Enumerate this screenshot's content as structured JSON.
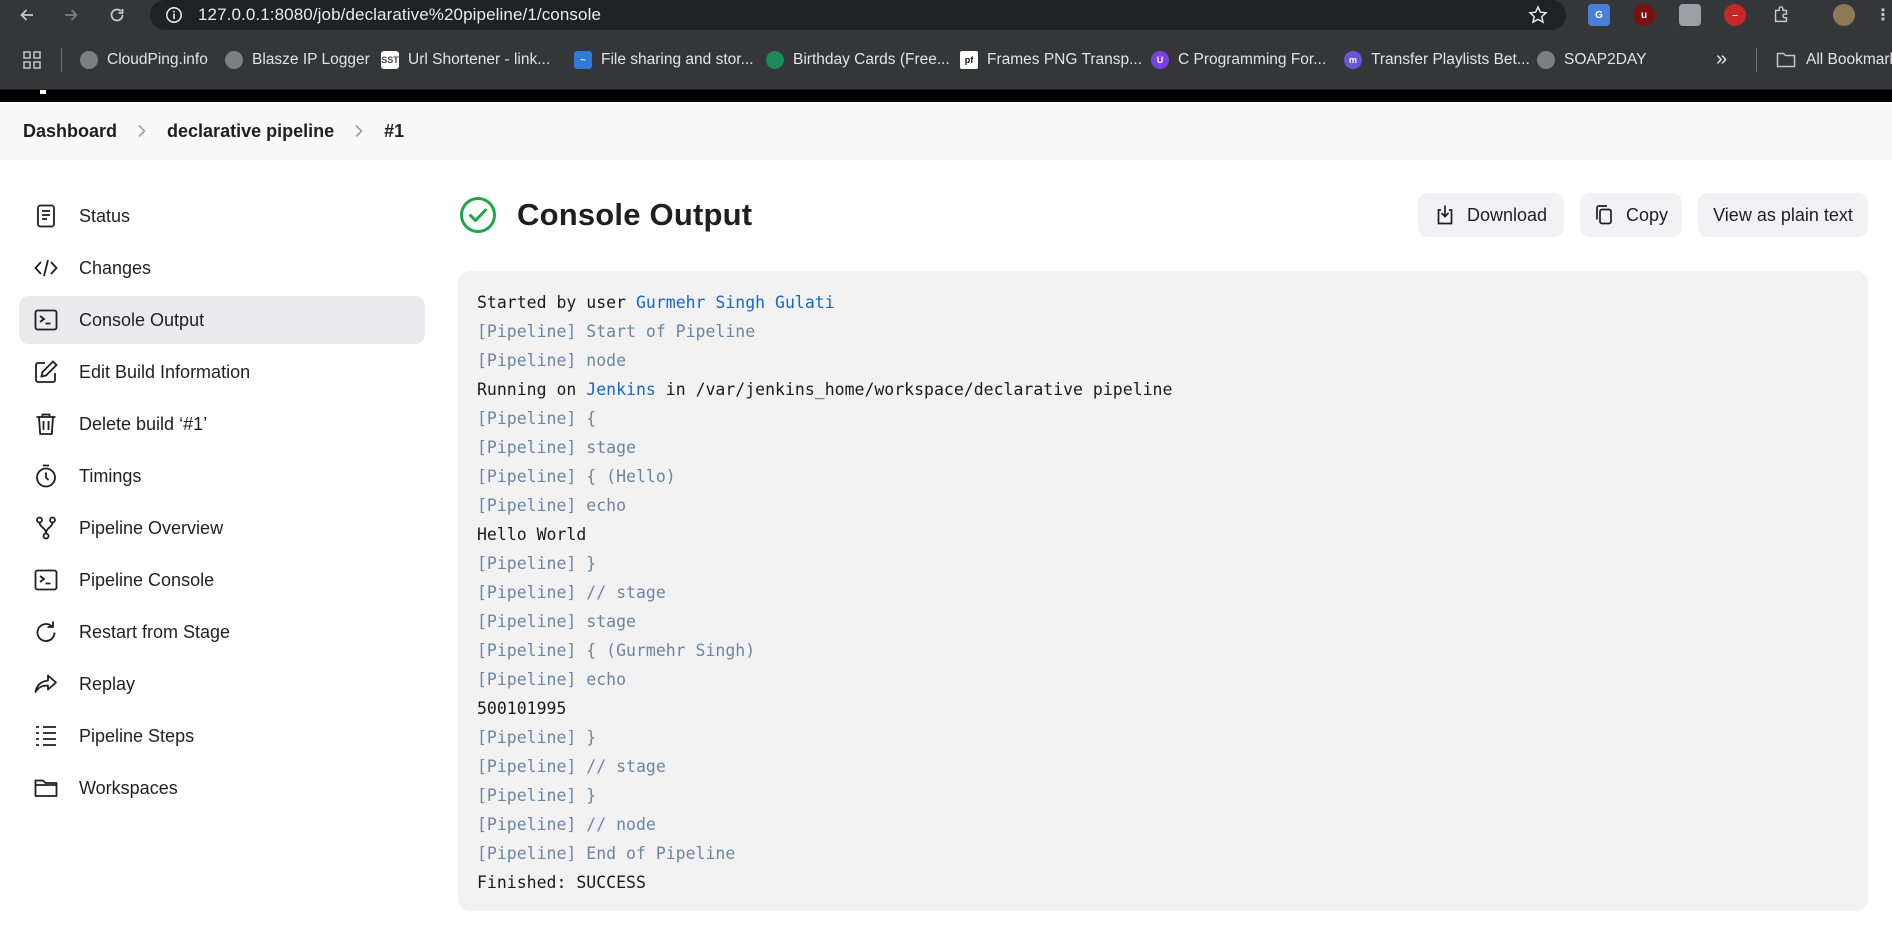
{
  "browser": {
    "url": "127.0.0.1:8080/job/declarative%20pipeline/1/console",
    "bookmarks": [
      {
        "label": "CloudPing.info"
      },
      {
        "label": "Blasze IP Logger"
      },
      {
        "label": "Url Shortener - link..."
      },
      {
        "label": "File sharing and stor..."
      },
      {
        "label": "Birthday Cards (Free..."
      },
      {
        "label": "Frames PNG Transp..."
      },
      {
        "label": "C Programming For..."
      },
      {
        "label": "Transfer Playlists Bet..."
      },
      {
        "label": "SOAP2DAY"
      }
    ],
    "all_bookmarks": "All Bookmarks"
  },
  "breadcrumb": {
    "items": [
      "Dashboard",
      "declarative pipeline",
      "#1"
    ]
  },
  "sidebar": {
    "items": [
      {
        "label": "Status"
      },
      {
        "label": "Changes"
      },
      {
        "label": "Console Output"
      },
      {
        "label": "Edit Build Information"
      },
      {
        "label": "Delete build ‘#1’"
      },
      {
        "label": "Timings"
      },
      {
        "label": "Pipeline Overview"
      },
      {
        "label": "Pipeline Console"
      },
      {
        "label": "Restart from Stage"
      },
      {
        "label": "Replay"
      },
      {
        "label": "Pipeline Steps"
      },
      {
        "label": "Workspaces"
      }
    ],
    "active": "Console Output"
  },
  "main": {
    "title": "Console Output",
    "buttons": {
      "download": "Download",
      "copy": "Copy",
      "plain": "View as plain text"
    },
    "console": {
      "started_prefix": "Started by user ",
      "user": "Gurmehr Singh Gulati",
      "running_prefix": "Running on ",
      "running_node": "Jenkins",
      "running_suffix": " in /var/jenkins_home/workspace/declarative pipeline",
      "pipeline_tag": "[Pipeline]",
      "lines": [
        " Start of Pipeline",
        " node",
        " {",
        " stage",
        " { (Hello)",
        " echo",
        " }",
        " // stage",
        " stage",
        " { (Gurmehr Singh)",
        " echo",
        " }",
        " // stage",
        " }",
        " // node",
        " End of Pipeline"
      ],
      "hello": "Hello World",
      "number": "500101995",
      "finished": "Finished: SUCCESS"
    }
  },
  "colors": {
    "success": "#1ea64a",
    "link": "#1568c7",
    "pipeline_text": "#6b85a3",
    "chrome_bg": "#35363a"
  }
}
